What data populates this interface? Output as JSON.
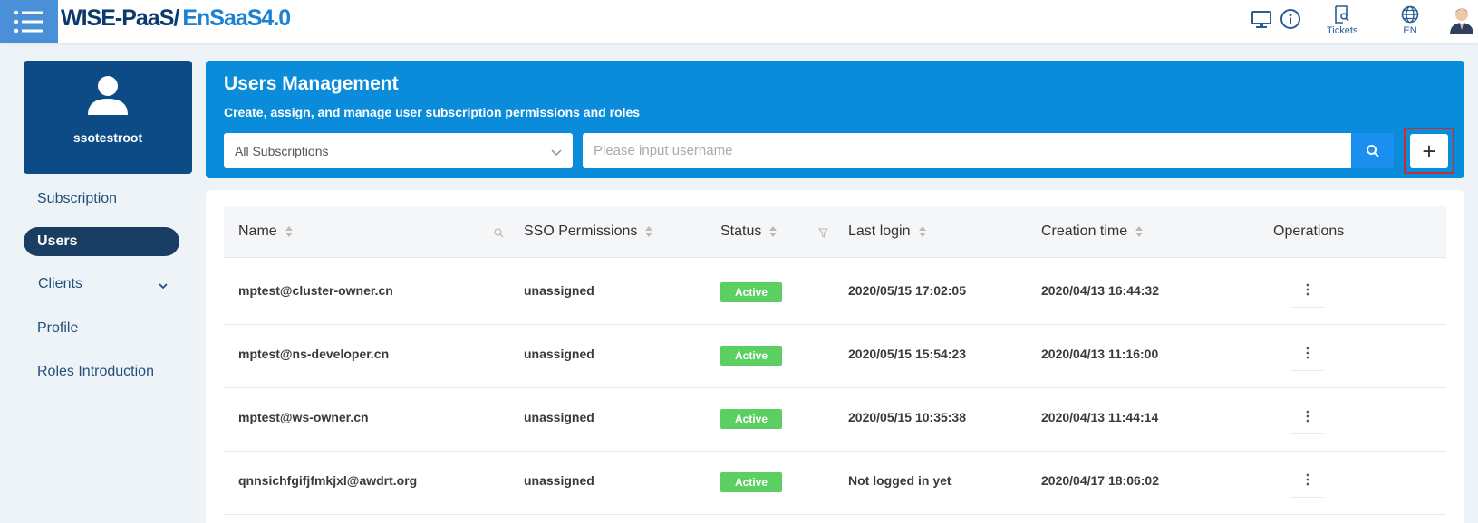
{
  "header": {
    "logo_part1": "WISE-PaaS/",
    "logo_part2": "EnSaaS4.0",
    "tickets_label": "Tickets",
    "lang_label": "EN"
  },
  "sidebar": {
    "username": "ssotestroot",
    "items": [
      {
        "label": "Subscription"
      },
      {
        "label": "Users"
      },
      {
        "label": "Clients"
      },
      {
        "label": "Profile"
      },
      {
        "label": "Roles Introduction"
      }
    ]
  },
  "banner": {
    "title": "Users Management",
    "subtitle": "Create, assign, and manage user subscription permissions and roles",
    "subscription_select": "All Subscriptions",
    "search_placeholder": "Please input username",
    "add_label": "+"
  },
  "table": {
    "columns": [
      "Name",
      "SSO Permissions",
      "Status",
      "Last login",
      "Creation time",
      "Operations"
    ],
    "rows": [
      {
        "name": "mptest@cluster-owner.cn",
        "sso": "unassigned",
        "status": "Active",
        "last_login": "2020/05/15 17:02:05",
        "created": "2020/04/13 16:44:32"
      },
      {
        "name": "mptest@ns-developer.cn",
        "sso": "unassigned",
        "status": "Active",
        "last_login": "2020/05/15 15:54:23",
        "created": "2020/04/13 11:16:00"
      },
      {
        "name": "mptest@ws-owner.cn",
        "sso": "unassigned",
        "status": "Active",
        "last_login": "2020/05/15 10:35:38",
        "created": "2020/04/13 11:44:14"
      },
      {
        "name": "qnnsichfgifjfmkjxl@awdrt.org",
        "sso": "unassigned",
        "status": "Active",
        "last_login": "Not logged in yet",
        "created": "2020/04/17 18:06:02"
      }
    ]
  },
  "colors": {
    "brand_dark": "#0c3a6e",
    "brand_blue": "#1a82d4",
    "banner_bg": "#0b8cdb",
    "active_badge": "#5bcf62",
    "highlight_border": "#d12a2a"
  }
}
